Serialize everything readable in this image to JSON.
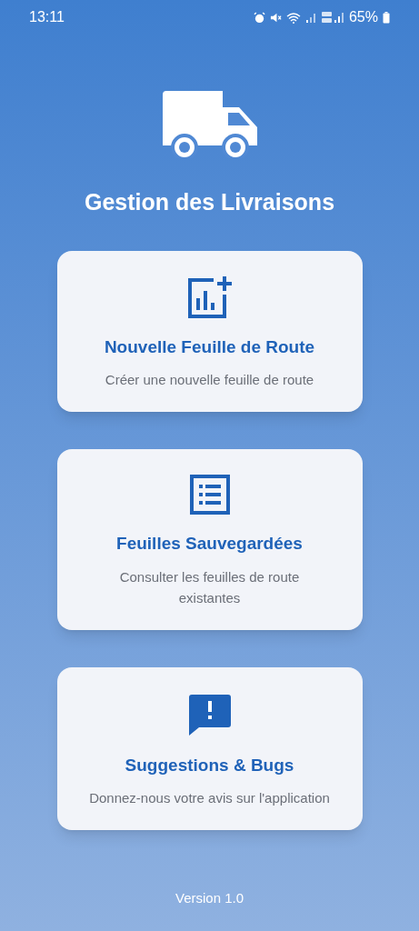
{
  "status_bar": {
    "time": "13:11",
    "battery": "65%"
  },
  "app": {
    "title": "Gestion des Livraisons"
  },
  "cards": [
    {
      "kind": "new-sheet",
      "title": "Nouvelle Feuille de Route",
      "subtitle": "Créer une nouvelle feuille de route"
    },
    {
      "kind": "list",
      "title": "Feuilles Sauvegardées",
      "subtitle": "Consulter les feuilles de route existantes"
    },
    {
      "kind": "feedback",
      "title": "Suggestions & Bugs",
      "subtitle": "Donnez-nous votre avis sur l'application"
    }
  ],
  "version": "Version 1.0"
}
